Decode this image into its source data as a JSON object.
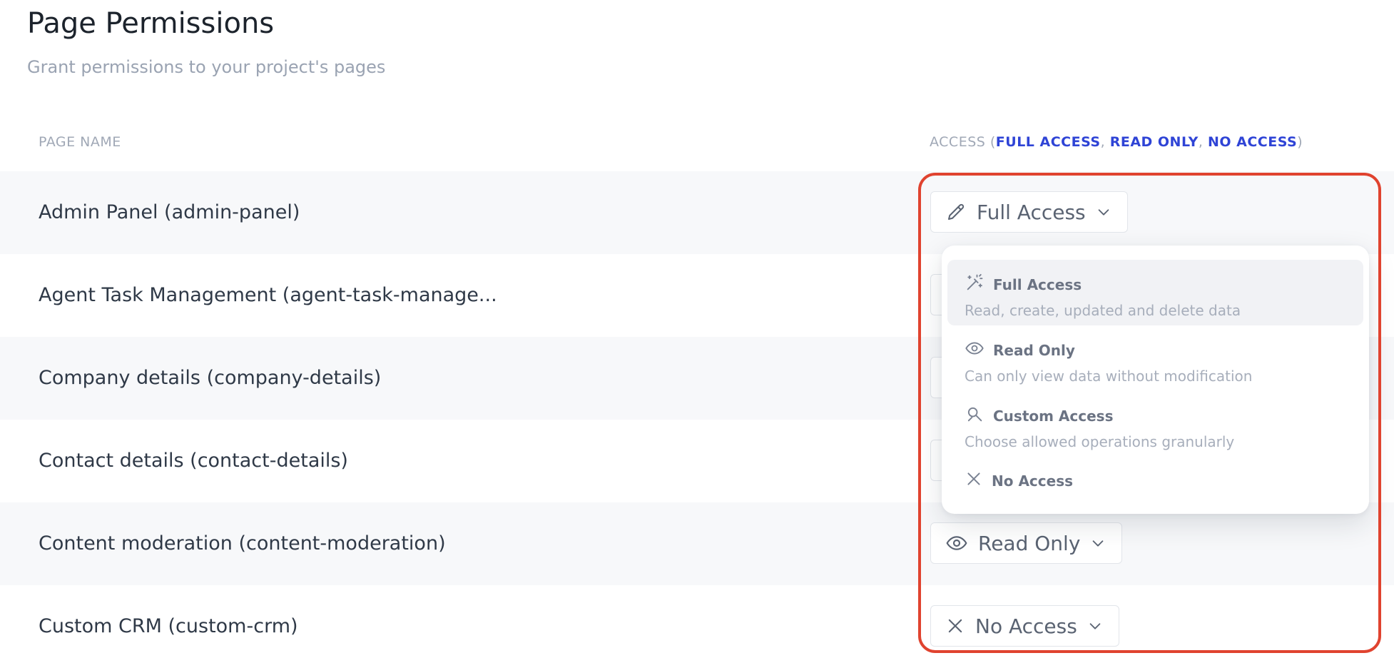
{
  "page": {
    "title": "Page Permissions",
    "subtitle": "Grant permissions to your project's pages"
  },
  "table": {
    "col_page_name": "PAGE NAME",
    "col_access_prefix": "ACCESS (",
    "col_access_opt1": "FULL ACCESS",
    "col_access_sep1": ", ",
    "col_access_opt2": "READ ONLY",
    "col_access_sep2": ", ",
    "col_access_opt3": "NO ACCESS",
    "col_access_suffix": ")",
    "rows": [
      {
        "label": "Admin Panel (admin-panel)",
        "access": "Full Access",
        "icon": "pencil-icon"
      },
      {
        "label": "Agent Task Management (agent-task-manage...",
        "access": "",
        "icon": ""
      },
      {
        "label": "Company details (company-details)",
        "access": "",
        "icon": ""
      },
      {
        "label": "Contact details (contact-details)",
        "access": "",
        "icon": ""
      },
      {
        "label": "Content moderation (content-moderation)",
        "access": "Read Only",
        "icon": "eye-icon"
      },
      {
        "label": "Custom CRM (custom-crm)",
        "access": "No Access",
        "icon": "x-icon"
      }
    ]
  },
  "dropdown": {
    "options": [
      {
        "label": "Full Access",
        "description": "Read, create, updated and delete data",
        "icon": "magic-wand-icon",
        "active": true
      },
      {
        "label": "Read Only",
        "description": "Can only view data without modification",
        "icon": "eye-icon",
        "active": false
      },
      {
        "label": "Custom Access",
        "description": "Choose allowed operations granularly",
        "icon": "custom-tool-icon",
        "active": false
      },
      {
        "label": "No Access",
        "description": "",
        "icon": "x-icon",
        "active": false
      }
    ]
  },
  "colors": {
    "accent": "#2f44d6",
    "highlight_border": "#e0432f",
    "row_alt_bg": "#f7f8fa"
  }
}
